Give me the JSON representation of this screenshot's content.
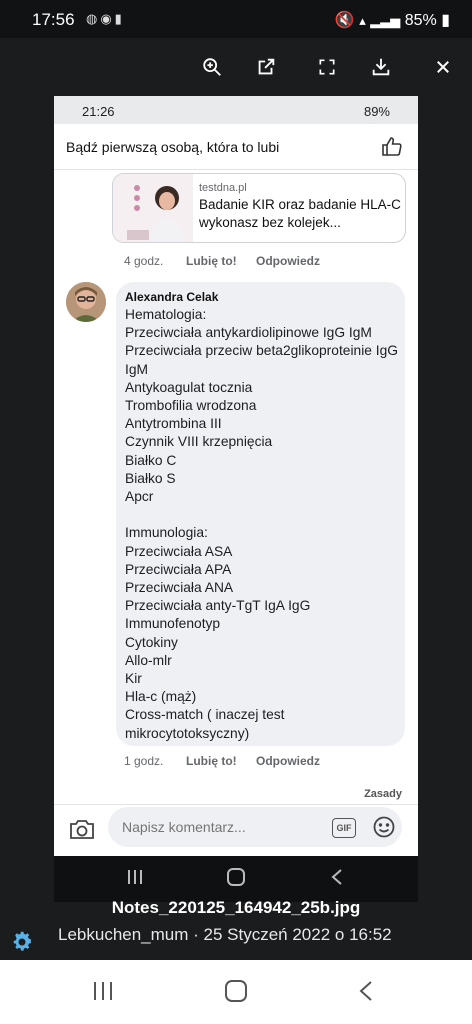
{
  "status": {
    "time": "17:56",
    "battery": "85%"
  },
  "viewer": {
    "zoom_icon": "zoom-in-icon",
    "open_icon": "open-external-icon",
    "fullscreen_icon": "fullscreen-icon",
    "download_icon": "download-icon",
    "close_icon": "close-icon"
  },
  "inner_status": {
    "time": "21:26",
    "battery": "89%"
  },
  "likes_prompt": "Bądź pierwszą osobą, która to lubi",
  "link_preview": {
    "domain": "testdna.pl",
    "title": "Badanie KIR oraz badanie HLA-C wykonasz bez kolejek..."
  },
  "reply_meta": {
    "time": "4 godz.",
    "like": "Lubię to!",
    "reply": "Odpowiedz"
  },
  "comment": {
    "author": "Alexandra Celak",
    "body": "Hematologia:\nPrzeciwciała antykardiolipinowe IgG IgM\nPrzeciwciała przeciw beta2glikoproteinie IgG IgM\nAntykoagulat tocznia\nTrombofilia wrodzona\nAntytrombina III\nCzynnik VIII krzepnięcia\nBiałko C\nBiałko S\nApcr\n\nImmunologia:\nPrzeciwciała ASA\nPrzeciwciała APA\nPrzeciwciała ANA\nPrzeciwciała anty-TgT IgA IgG\nImmunofenotyp\nCytokiny\nAllo-mlr\nKir\nHla-c (mąż)\nCross-match ( inaczej test mikrocytotoksyczny)"
  },
  "comment_meta": {
    "time": "1 godz.",
    "like": "Lubię to!",
    "reply": "Odpowiedz"
  },
  "rules_link": "Zasady",
  "composer": {
    "placeholder": "Napisz komentarz...",
    "gif": "GIF"
  },
  "caption": {
    "filename": "Notes_220125_164942_25b.jpg",
    "meta": "Lebkuchen_mum · 25 Styczeń 2022 o 16:52"
  }
}
